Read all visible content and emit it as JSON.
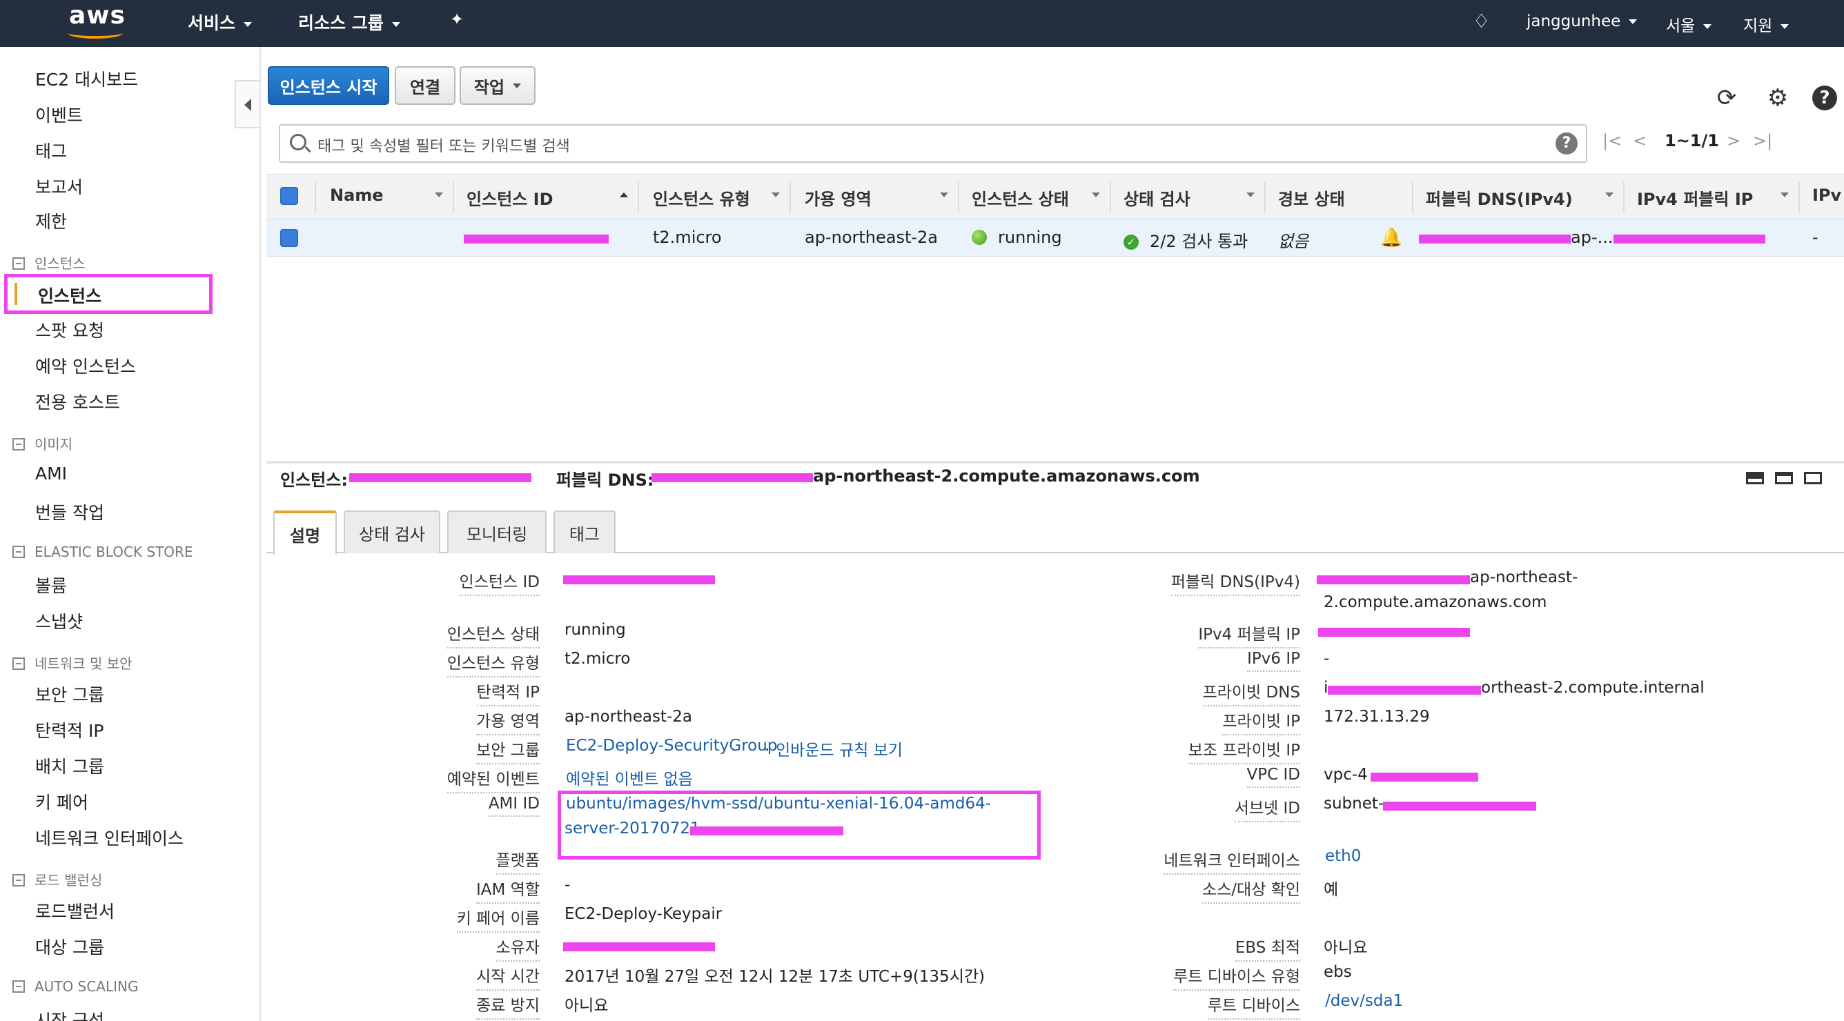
{
  "topnav": {
    "logo": "aws",
    "services": "서비스",
    "resource_groups": "리소스 그룹",
    "user": "janggunhee",
    "region": "서울",
    "support": "지원"
  },
  "sidebar": {
    "dashboard": "EC2 대시보드",
    "events": "이벤트",
    "tags": "태그",
    "reports": "보고서",
    "limits": "제한",
    "sec_instances": "인스턴스",
    "instances": "인스턴스",
    "spot": "스팟 요청",
    "reserved": "예약 인스턴스",
    "dedicated": "전용 호스트",
    "sec_images": "이미지",
    "ami": "AMI",
    "bundle": "번들 작업",
    "sec_ebs": "ELASTIC BLOCK STORE",
    "volumes": "볼륨",
    "snapshots": "스냅샷",
    "sec_network": "네트워크 및 보안",
    "security_groups": "보안 그룹",
    "elastic_ip": "탄력적 IP",
    "placement": "배치 그룹",
    "keypair": "키 페어",
    "nic": "네트워크 인터페이스",
    "sec_lb": "로드 밸런싱",
    "load_balancers": "로드밸런서",
    "target_groups": "대상 그룹",
    "sec_as": "AUTO SCALING",
    "launch_config": "시작 구성"
  },
  "toolbar": {
    "launch": "인스턴스 시작",
    "connect": "연결",
    "actions": "작업"
  },
  "search": {
    "placeholder": "태그 및 속성별 필터 또는 키워드별 검색",
    "pager": "1~1/1"
  },
  "table": {
    "headers": [
      "Name",
      "인스턴스 ID",
      "인스턴스 유형",
      "가용 영역",
      "인스턴스 상태",
      "상태 검사",
      "경보 상태",
      "퍼블릭 DNS(IPv4)",
      "IPv4 퍼블릭 IP",
      "IPv"
    ],
    "row": {
      "type": "t2.micro",
      "zone": "ap-northeast-2a",
      "state": "running",
      "check": "2/2 검사 통과",
      "alarm": "없음",
      "dns_tail": "ap-...",
      "ipv6": "-"
    }
  },
  "detail": {
    "instance_label": "인스턴스:",
    "dns_label": "퍼블릭 DNS:",
    "dns_suffix": "ap-northeast-2.compute.amazonaws.com",
    "tabs": [
      "설명",
      "상태 검사",
      "모니터링",
      "태그"
    ],
    "left": {
      "instance_id": "인스턴스 ID",
      "state": "인스턴스 상태",
      "state_val": "running",
      "type": "인스턴스 유형",
      "type_val": "t2.micro",
      "elastic_ip": "탄력적 IP",
      "zone": "가용 영역",
      "zone_val": "ap-northeast-2a",
      "sg": "보안 그룹",
      "sg_val": "EC2-Deploy-SecurityGroup",
      "sg_rules": "인바운드 규칙 보기",
      "events": "예약된 이벤트",
      "events_val": "예약된 이벤트 없음",
      "ami": "AMI ID",
      "ami_val1": "ubuntu/images/hvm-ssd/ubuntu-xenial-16.04-amd64-",
      "ami_val2": "server-20170721",
      "platform": "플랫폼",
      "iam": "IAM 역할",
      "iam_val": "-",
      "keyname": "키 페어 이름",
      "keyname_val": "EC2-Deploy-Keypair",
      "owner": "소유자",
      "launch": "시작 시간",
      "launch_val": "2017년 10월 27일 오전 12시 12분 17초 UTC+9(135시간)",
      "termination": "종료 방지",
      "termination_val": "아니요"
    },
    "right": {
      "public_dns": "퍼블릭 DNS(IPv4)",
      "public_dns_val1": "ap-northeast-",
      "public_dns_val2": "2.compute.amazonaws.com",
      "ipv4": "IPv4 퍼블릭 IP",
      "ipv6": "IPv6 IP",
      "ipv6_val": "-",
      "private_dns": "프라이빗 DNS",
      "private_dns_val": "ortheast-2.compute.internal",
      "private_ip": "프라이빗 IP",
      "private_ip_val": "172.31.13.29",
      "secondary": "보조 프라이빗 IP",
      "vpc": "VPC ID",
      "vpc_val": "vpc-4",
      "subnet": "서브넷 ID",
      "subnet_val": "subnet-",
      "nic": "네트워크 인터페이스",
      "nic_val": "eth0",
      "srcdst": "소스/대상 확인",
      "srcdst_val": "예",
      "ebs": "EBS 최적",
      "ebs_val": "아니요",
      "root_type": "루트 디바이스 유형",
      "root_type_val": "ebs",
      "root_dev": "루트 디바이스",
      "root_dev_val": "/dev/sda1"
    }
  },
  "colors": {
    "nav_bg": "#232f3e",
    "accent": "#f90",
    "highlight": "#ee44ee",
    "primary_btn": "#1d64b5",
    "link": "#1a5ea8"
  }
}
